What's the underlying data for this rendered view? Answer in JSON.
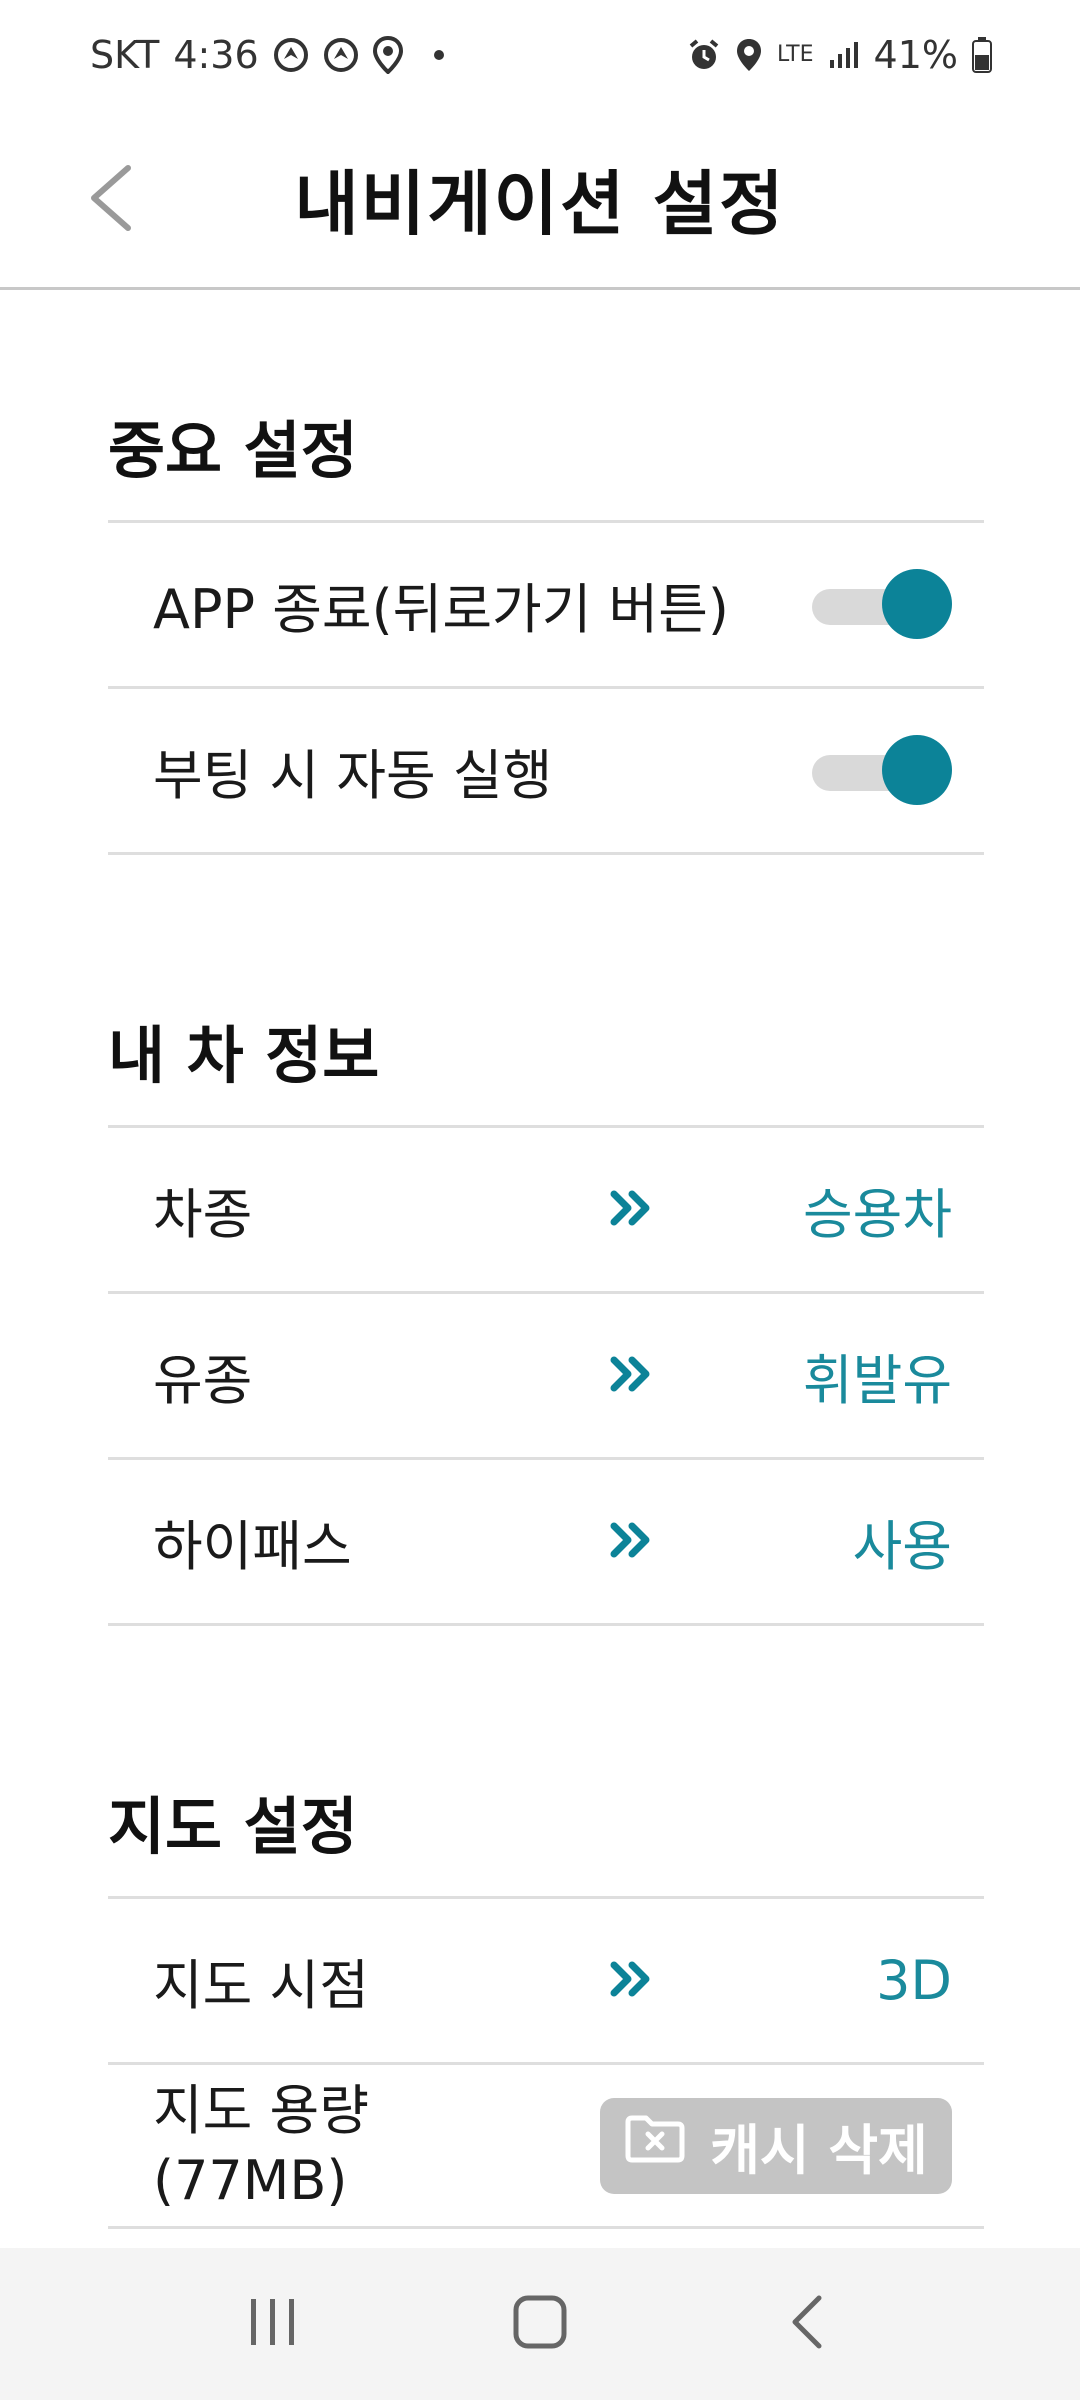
{
  "status_bar": {
    "carrier": "SKT",
    "time": "4:36",
    "network": "LTE",
    "battery": "41%",
    "icons": [
      "navigation-icon",
      "navigation-icon",
      "location-icon",
      "dot-icon",
      "alarm-icon",
      "location-icon",
      "signal-icon",
      "battery-icon"
    ]
  },
  "header": {
    "title": "내비게이션 설정",
    "back_icon": "chevron-left-icon"
  },
  "sections": {
    "important": {
      "title": "중요 설정",
      "items": [
        {
          "label": "APP 종료(뒤로가기 버튼)",
          "toggle_on": true
        },
        {
          "label": "부팅 시 자동 실행",
          "toggle_on": true
        }
      ]
    },
    "car": {
      "title": "내 차 정보",
      "items": [
        {
          "label": "차종",
          "value": "승용차"
        },
        {
          "label": "유종",
          "value": "휘발유"
        },
        {
          "label": "하이패스",
          "value": "사용"
        }
      ]
    },
    "map": {
      "title": "지도 설정",
      "items": [
        {
          "label": "지도 시점",
          "value": "3D"
        }
      ],
      "capacity": {
        "label_line1": "지도 용량",
        "label_line2": "(77MB)",
        "button_label": "캐시 삭제"
      }
    }
  },
  "colors": {
    "accent": "#0c8398",
    "value_text": "#1a8a9c",
    "divider": "#dedede"
  }
}
